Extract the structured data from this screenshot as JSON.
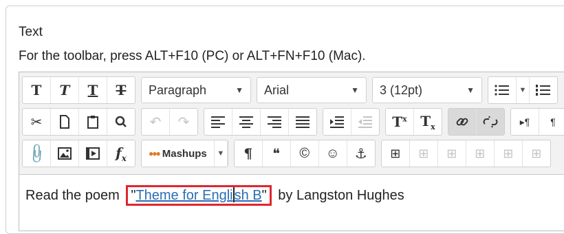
{
  "field": {
    "label": "Text",
    "hint": "For the toolbar, press ALT+F10 (PC) or ALT+FN+F10 (Mac)."
  },
  "toolbar": {
    "row1": {
      "bold": "T",
      "italic": "T",
      "underline": "T",
      "strike": "T",
      "paragraph_format": "Paragraph",
      "font_family": "Arial",
      "font_size": "3 (12pt)"
    },
    "row2": {
      "superscript_T": "T",
      "superscript_x": "x",
      "subscript_T": "T",
      "subscript_x": "x",
      "paste_symbol": "¶"
    },
    "row3": {
      "math_f": "f",
      "math_x": "x",
      "mashups_label": "Mashups",
      "paragraph_mark": "¶",
      "quote_mark": "❝",
      "copyright": "©",
      "emoticon": "☺",
      "anchor": "⚓"
    }
  },
  "content": {
    "before": "Read the poem ",
    "quote_open": "\"",
    "link_part1": "Theme for Engli",
    "link_part2": "sh B",
    "quote_close": "\"",
    "after": " by Langston Hughes"
  },
  "colors": {
    "highlight_border": "#e0262e",
    "link": "#2a6db5",
    "toolbar_bg": "#f2f2f2"
  }
}
